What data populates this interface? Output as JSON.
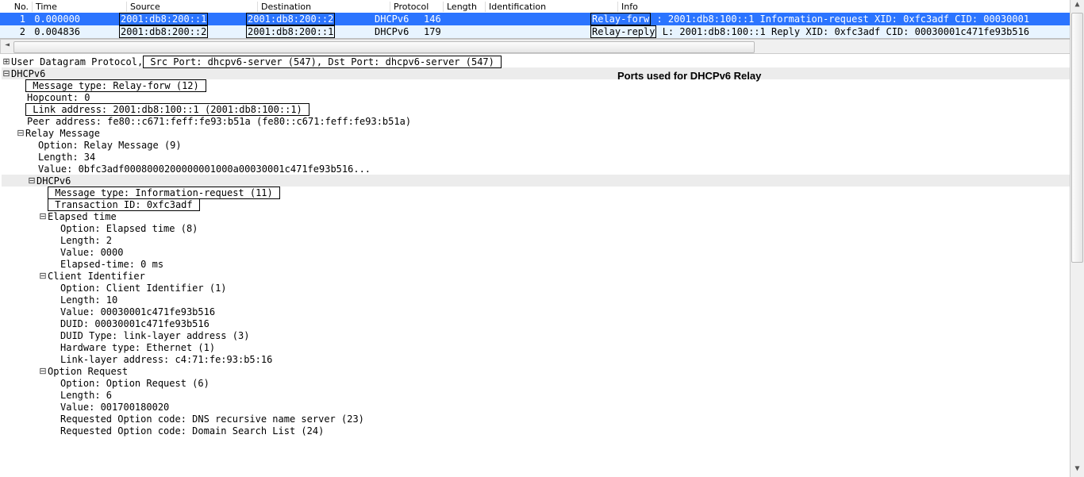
{
  "packet_list": {
    "headers": [
      "No.",
      "Time",
      "Source",
      "Destination",
      "Protocol",
      "Length",
      "Identification",
      "Info"
    ],
    "rows": [
      {
        "no": "1",
        "time": "0.000000",
        "src": "2001:db8:200::1",
        "dst": "2001:db8:200::2",
        "proto": "DHCPv6",
        "len": "146",
        "id": "",
        "info_prefix": "Relay-forw",
        "info_rest": " : 2001:db8:100::1 Information-request XID: 0xfc3adf CID: 00030001"
      },
      {
        "no": "2",
        "time": "0.004836",
        "src": "2001:db8:200::2",
        "dst": "2001:db8:200::1",
        "proto": "DHCPv6",
        "len": "179",
        "id": "",
        "info_prefix": "Relay-reply",
        "info_rest": " L: 2001:db8:100::1 Reply XID: 0xfc3adf CID: 00030001c471fe93b516"
      }
    ]
  },
  "annotation": "Ports used for DHCPv6 Relay",
  "details": {
    "udp_prefix": "User Datagram Protocol,",
    "udp_ports": " Src Port: dhcpv6-server (547), Dst Port: dhcpv6-server (547) ",
    "dhcpv6_label": "DHCPv6",
    "msg_type": " Message type: Relay-forw (12) ",
    "hopcount": "Hopcount: 0",
    "link_addr": " Link address: 2001:db8:100::1 (2001:db8:100::1) ",
    "peer_addr": "Peer address: fe80::c671:feff:fe93:b51a (fe80::c671:feff:fe93:b51a)",
    "relay_msg": {
      "label": "Relay Message",
      "option": "Option: Relay Message (9)",
      "length": "Length: 34",
      "value": "Value: 0bfc3adf0008000200000001000a00030001c471fe93b516..."
    },
    "inner": {
      "label": "DHCPv6",
      "msg_type": " Message type: Information-request (11) ",
      "xid": " Transaction ID: 0xfc3adf ",
      "elapsed": {
        "label": "Elapsed time",
        "option": "Option: Elapsed time (8)",
        "length": "Length: 2",
        "value": "Value: 0000",
        "elapsed": "Elapsed-time: 0 ms"
      },
      "cid": {
        "label": "Client Identifier",
        "option": "Option: Client Identifier (1)",
        "length": "Length: 10",
        "value": "Value: 00030001c471fe93b516",
        "duid": "DUID: 00030001c471fe93b516",
        "duid_type": "DUID Type: link-layer address (3)",
        "hw_type": "Hardware type: Ethernet (1)",
        "ll_addr": "Link-layer address: c4:71:fe:93:b5:16"
      },
      "oro": {
        "label": "Option Request",
        "option": "Option: Option Request (6)",
        "length": "Length: 6",
        "value": "Value: 001700180020",
        "req1": "Requested Option code: DNS recursive name server (23)",
        "req2": "Requested Option code: Domain Search List (24)"
      }
    }
  }
}
